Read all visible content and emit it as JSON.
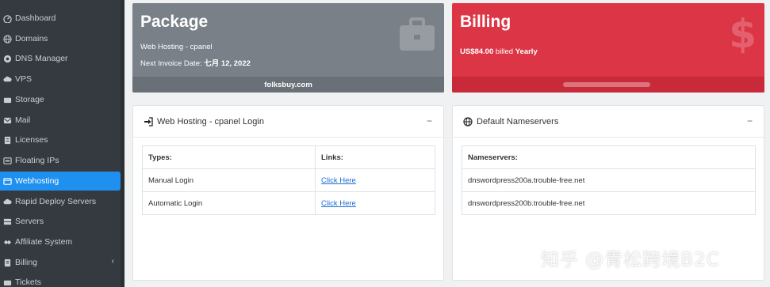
{
  "sidebar": {
    "items": [
      {
        "label": "Dashboard",
        "icon": "dashboard-icon"
      },
      {
        "label": "Domains",
        "icon": "globe-icon"
      },
      {
        "label": "DNS Manager",
        "icon": "dns-icon"
      },
      {
        "label": "VPS",
        "icon": "cloud-icon"
      },
      {
        "label": "Storage",
        "icon": "storage-icon"
      },
      {
        "label": "Mail",
        "icon": "mail-icon"
      },
      {
        "label": "Licenses",
        "icon": "license-icon"
      },
      {
        "label": "Floating IPs",
        "icon": "floating-ip-icon"
      },
      {
        "label": "Webhosting",
        "icon": "webhosting-icon",
        "active": true
      },
      {
        "label": "Rapid Deploy Servers",
        "icon": "cloud-icon"
      },
      {
        "label": "Servers",
        "icon": "server-icon"
      },
      {
        "label": "Affiliate System",
        "icon": "handshake-icon"
      },
      {
        "label": "Billing",
        "icon": "billing-icon",
        "chevron": "chevron-left-icon"
      },
      {
        "label": "Tickets",
        "icon": "ticket-icon"
      }
    ],
    "colors": {
      "background": "#343a40",
      "active": "#1f8ff0"
    }
  },
  "package": {
    "title": "Package",
    "plan": "Web Hosting - cpanel",
    "next_invoice_label": "Next Invoice Date: ",
    "next_invoice_date": "七月 12, 2022",
    "domain": "folksbuy.com",
    "icon": "briefcase-icon",
    "color": "#7a8088"
  },
  "billing": {
    "title": "Billing",
    "amount": "US$84.00",
    "billed_text": " billed ",
    "cycle": "Yearly",
    "icon": "dollar-icon",
    "color": "#dc3545"
  },
  "login_panel": {
    "title": "Web Hosting - cpanel Login",
    "icon": "sign-in-icon",
    "collapse": "−",
    "headers": [
      "Types:",
      "Links:"
    ],
    "rows": [
      {
        "type": "Manual Login",
        "link": "Click Here"
      },
      {
        "type": "Automatic Login",
        "link": "Click Here"
      }
    ]
  },
  "nameserver_panel": {
    "title": "Default Nameservers",
    "icon": "globe-icon",
    "collapse": "−",
    "header": "Nameservers:",
    "rows": [
      "dnswordpress200a.trouble-free.net",
      "dnswordpress200b.trouble-free.net"
    ]
  },
  "watermark": "知乎 @青松跨境B2C"
}
